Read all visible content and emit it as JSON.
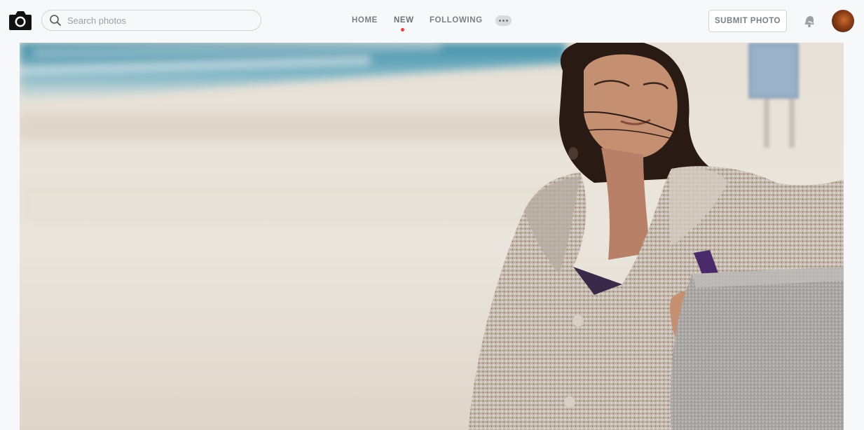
{
  "search": {
    "placeholder": "Search photos",
    "value": ""
  },
  "nav": {
    "items": [
      {
        "label": "HOME",
        "active": false
      },
      {
        "label": "NEW",
        "active": true
      },
      {
        "label": "FOLLOWING",
        "active": false
      }
    ]
  },
  "actions": {
    "submit_label": "SUBMIT PHOTO"
  },
  "icons": {
    "logo": "camera-icon",
    "search": "search-icon",
    "more": "more-dots-icon",
    "notifications": "bell-icon",
    "avatar": "user-avatar"
  },
  "colors": {
    "active_indicator": "#e0413a",
    "nav_text": "#7a7f85"
  }
}
